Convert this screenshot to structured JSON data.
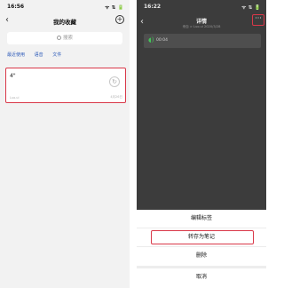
{
  "left": {
    "status": {
      "time": "16:56",
      "indicators": "ᯤ ⇅ 🔋"
    },
    "nav": {
      "back": "‹",
      "title": "我的收藏",
      "add": "+"
    },
    "search": {
      "placeholder": "搜索"
    },
    "filters": [
      "最近使用",
      "语音",
      "文件"
    ],
    "card": {
      "text": "4\"",
      "action": "↻",
      "source": "Luo.ui",
      "date": "4月26日"
    }
  },
  "right": {
    "status": {
      "time": "16:22",
      "indicators": "ᯤ ⇅ 🔋"
    },
    "nav": {
      "back": "‹",
      "title": "详情",
      "subtitle": "来自 > Luo.ui 2020/3/28",
      "more": "···"
    },
    "voice": {
      "label": "00:04"
    },
    "sheet": {
      "items": [
        "编辑标签",
        "转存为笔记",
        "删除"
      ],
      "cancel": "取消"
    }
  },
  "colors": {
    "highlight": "#d93849",
    "link": "#2a58b8",
    "voice_icon": "#45c45a"
  }
}
